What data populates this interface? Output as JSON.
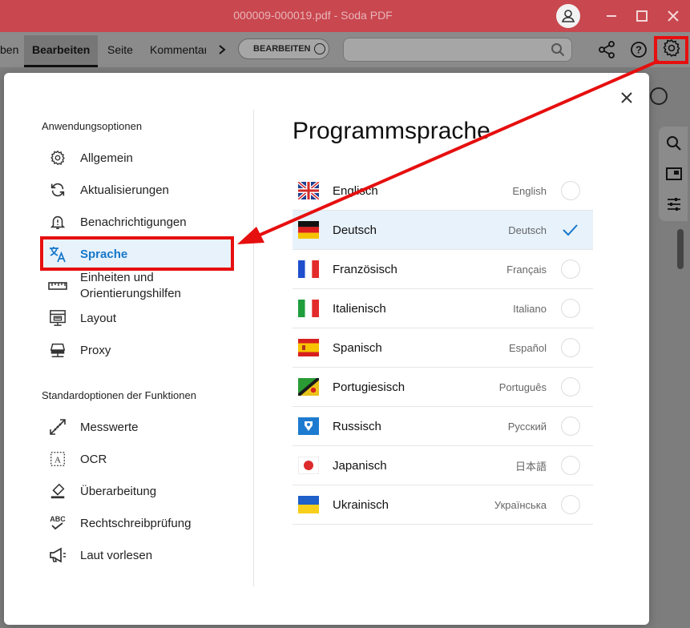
{
  "titlebar": {
    "title": "000009-000019.pdf  -  Soda PDF"
  },
  "toolbar": {
    "tabs": [
      {
        "label": "ben"
      },
      {
        "label": "Bearbeiten"
      },
      {
        "label": "Seite"
      },
      {
        "label": "Kommentar"
      }
    ],
    "mode_pill": "BEARBEITEN",
    "search_placeholder": ""
  },
  "dialog": {
    "section_app": "Anwendungsoptionen",
    "app_items": [
      {
        "label": "Allgemein",
        "icon": "gear-icon"
      },
      {
        "label": "Aktualisierungen",
        "icon": "sync-icon"
      },
      {
        "label": "Benachrichtigungen",
        "icon": "bell-icon"
      },
      {
        "label": "Sprache",
        "icon": "translate-icon"
      },
      {
        "label": "Einheiten und Orientierungshilfen",
        "icon": "ruler-icon"
      },
      {
        "label": "Layout",
        "icon": "layout-icon"
      },
      {
        "label": "Proxy",
        "icon": "proxy-icon"
      }
    ],
    "section_features": "Standardoptionen der Funktionen",
    "feature_items": [
      {
        "label": "Messwerte",
        "icon": "measure-icon"
      },
      {
        "label": "OCR",
        "icon": "ocr-icon"
      },
      {
        "label": "Überarbeitung",
        "icon": "eraser-icon"
      },
      {
        "label": "Rechtschreibprüfung",
        "icon": "spellcheck-icon"
      },
      {
        "label": "Laut vorlesen",
        "icon": "megaphone-icon"
      }
    ],
    "main_title": "Programmsprache",
    "languages": [
      {
        "name": "Englisch",
        "native": "English",
        "selected": false
      },
      {
        "name": "Deutsch",
        "native": "Deutsch",
        "selected": true
      },
      {
        "name": "Französisch",
        "native": "Français",
        "selected": false
      },
      {
        "name": "Italienisch",
        "native": "Italiano",
        "selected": false
      },
      {
        "name": "Spanisch",
        "native": "Español",
        "selected": false
      },
      {
        "name": "Portugiesisch",
        "native": "Português",
        "selected": false
      },
      {
        "name": "Russisch",
        "native": "Русский",
        "selected": false
      },
      {
        "name": "Japanisch",
        "native": "日本語",
        "selected": false
      },
      {
        "name": "Ukrainisch",
        "native": "Українська",
        "selected": false
      }
    ]
  },
  "colors": {
    "accent": "#1677c9",
    "highlight_red": "#e60f0f",
    "selected_bg": "#e7f2fb",
    "titlebar": "#c9474f"
  }
}
